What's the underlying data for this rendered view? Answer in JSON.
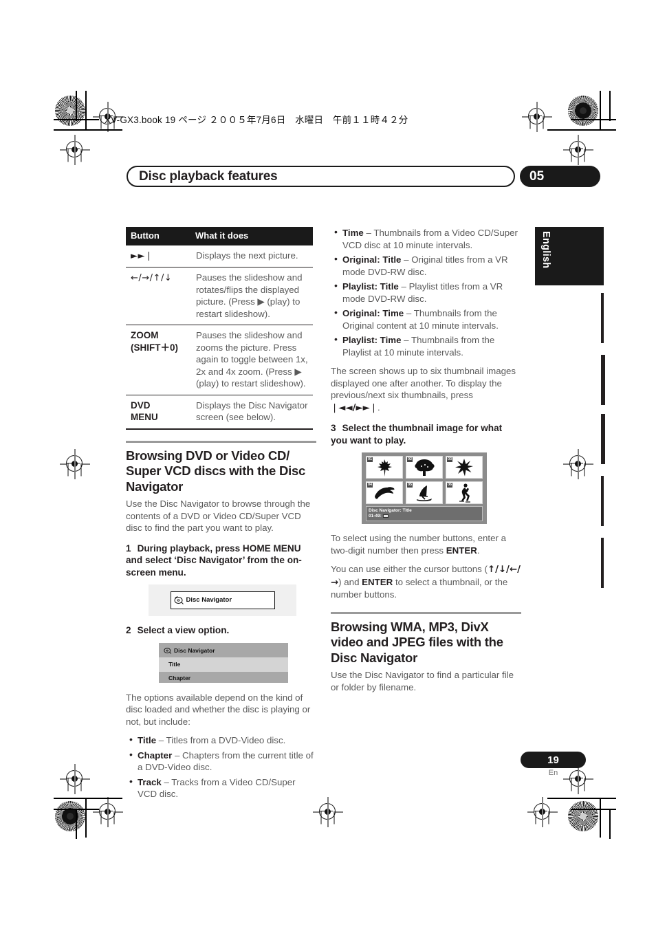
{
  "print_marks": {
    "file_stamp": "XV-GX3.book  19 ページ  ２００５年7月6日　水曜日　午前１１時４２分"
  },
  "running_head": {
    "title": "Disc playback features",
    "chapter_number": "05"
  },
  "language_tab": {
    "label": "English"
  },
  "button_table": {
    "headers": [
      "Button",
      "What it does"
    ],
    "rows": [
      {
        "button": "►►❘",
        "button_is_symbol": true,
        "description": "Displays the next picture."
      },
      {
        "button": "←/→/↑/↓",
        "button_is_symbol": true,
        "description": "Pauses the slideshow and rotates/flips the displayed picture. (Press ▶ (play) to restart slideshow)."
      },
      {
        "button": "ZOOM\n(SHIFT+0)",
        "button_is_symbol": false,
        "description": "Pauses the slideshow and zooms the picture. Press again to toggle between 1x, 2x and 4x zoom. (Press ▶ (play) to restart slideshow)."
      },
      {
        "button": "DVD MENU",
        "button_is_symbol": false,
        "description": "Displays the Disc Navigator screen (see below)."
      }
    ]
  },
  "section_dvd": {
    "heading": "Browsing DVD or Video CD/ Super VCD discs with the Disc Navigator",
    "intro": "Use the Disc Navigator to browse through the contents of a DVD or Video CD/Super VCD disc to find the part you want to play.",
    "step1_number": "1",
    "step1_text": "During playback, press HOME MENU and select ‘Disc Navigator’ from the on-screen menu.",
    "osd_button_label": "Disc Navigator",
    "step2_number": "2",
    "step2_text": "Select a view option.",
    "osd_menu": {
      "title": "Disc Navigator",
      "items": [
        {
          "label": "Title",
          "selected": true
        },
        {
          "label": "Chapter",
          "selected": false
        }
      ]
    },
    "options_intro": "The options available depend on the kind of disc loaded and whether the disc is playing or not, but include:",
    "options": [
      {
        "term": "Title",
        "desc": " – Titles from a DVD-Video disc."
      },
      {
        "term": "Chapter",
        "desc": " – Chapters from the current title of a DVD-Video disc."
      },
      {
        "term": "Track",
        "desc": " – Tracks from a Video CD/Super VCD disc."
      }
    ]
  },
  "right_column": {
    "options_continued": [
      {
        "term": "Time",
        "desc": " – Thumbnails from a Video CD/Super VCD disc at 10 minute intervals."
      },
      {
        "term": "Original: Title",
        "desc": " – Original titles from a VR mode DVD-RW disc."
      },
      {
        "term": "Playlist: Title",
        "desc": " – Playlist titles from a VR mode DVD-RW disc."
      },
      {
        "term": "Original: Time",
        "desc": " – Thumbnails from the Original content at 10 minute intervals."
      },
      {
        "term": "Playlist: Time",
        "desc": " – Thumbnails from the Playlist at 10 minute intervals."
      }
    ],
    "screen_note_a": "The screen shows up to six thumbnail images displayed one after another. To display the previous/next six thumbnails, press ",
    "screen_note_symbols": "❘◄◄/►►❘",
    "screen_note_b": ".",
    "step3_number": "3",
    "step3_text": "Select the thumbnail image for what you want to play.",
    "osd_grid": {
      "thumbnails": [
        {
          "num": "01",
          "icon": "maple-leaf-icon"
        },
        {
          "num": "02",
          "icon": "tree-icon"
        },
        {
          "num": "03",
          "icon": "flower-icon"
        },
        {
          "num": "04",
          "icon": "bird-icon"
        },
        {
          "num": "05",
          "icon": "windsurfer-icon"
        },
        {
          "num": "06",
          "icon": "skater-icon"
        }
      ],
      "caption_line1": "Disc Navigator: Title",
      "caption_line2": "01-49:"
    },
    "note_number_buttons": "To select using the number buttons, enter a two-digit number then press ENTER.",
    "note_cursor_a": "You can use either the cursor buttons (",
    "note_cursor_symbols_1": "↑/↓/",
    "note_cursor_symbols_2": "←/→",
    "note_cursor_b": ") and ",
    "note_cursor_enter": "ENTER",
    "note_cursor_c": " to select a thumbnail, or the number buttons."
  },
  "section_wma": {
    "heading": "Browsing WMA, MP3, DivX video and JPEG files with the Disc Navigator",
    "intro": "Use the Disc Navigator to find a particular file or folder by filename."
  },
  "footer": {
    "page_number": "19",
    "page_language": "En"
  }
}
